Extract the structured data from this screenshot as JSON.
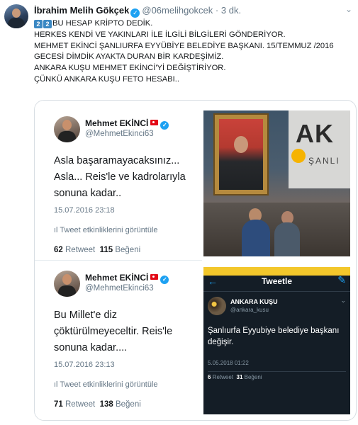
{
  "tweet": {
    "author_name": "İbrahim Melih Gökçek",
    "handle": "@06melihgokcek",
    "separator": "·",
    "time": "3 dk.",
    "keycap_1": "2",
    "keycap_2": "2",
    "lines": [
      "BU HESAP KRİPTO DEDİK.",
      "HERKES KENDİ VE YAKINLARI İLE İLGİLİ BİLGİLERİ GÖNDERİYOR.",
      "MEHMET EKİNCİ ŞANLIURFA EYYÜBİYE BELEDİYE BAŞKANI. 15/TEMMUZ /2016",
      "GECESİ DİMDİK AYAKTA DURAN BİR KARDEŞİMİZ.",
      "ANKARA KUŞU MEHMET EKİNCİ'Yİ DEĞİŞTİRİYOR.",
      "ÇÜNKÜ ANKARA KUŞU FETO HESABI.."
    ]
  },
  "embedded": {
    "tweet1": {
      "name": "Mehmet EKİNCİ",
      "handle": "@MehmetEkinci63",
      "body": [
        "Asla başaramayacaksınız...",
        "Asla... Reis'le ve kadrolarıyla",
        "sonuna kadar.."
      ],
      "timestamp": "15.07.2016 23:18",
      "activity": "Tweet etkinliklerini görüntüle",
      "retweets": "62",
      "retweet_label": "Retweet",
      "likes": "115",
      "like_label": "Beğeni"
    },
    "tweet2": {
      "name": "Mehmet EKİNCİ",
      "handle": "@MehmetEkinci63",
      "body": [
        "Bu Millet'e diz",
        "çöktürülmeyeceltir. Reis'le",
        "sonuna kadar...."
      ],
      "timestamp": "15.07.2016 23:13",
      "activity": "Tweet etkinliklerini görüntüle",
      "retweets": "71",
      "retweet_label": "Retweet",
      "likes": "138",
      "like_label": "Beğeni"
    },
    "photo_sign": {
      "big": "AK",
      "small": "ŞANLI"
    },
    "screenshot": {
      "header_title": "Tweetle",
      "name": "ANKARA KUŞU",
      "handle": "@ankara_kusu",
      "text": "Şanlıurfa Eyyubiye belediye başkanı değişir.",
      "date": "5.05.2018 01:22",
      "retweets": "6",
      "retweet_label": "Retweet",
      "likes": "31",
      "like_label": "Beğeni"
    }
  },
  "icons": {
    "verified": "verified-badge-icon",
    "flag": "turkey-flag-icon",
    "chevron": "chevron-down-icon",
    "activity": "bar-chart-icon"
  },
  "colors": {
    "accent": "#1da1f2",
    "secondary_text": "#657786",
    "screenshot_bg": "#141d26",
    "screenshot_border": "#f3c72b"
  }
}
